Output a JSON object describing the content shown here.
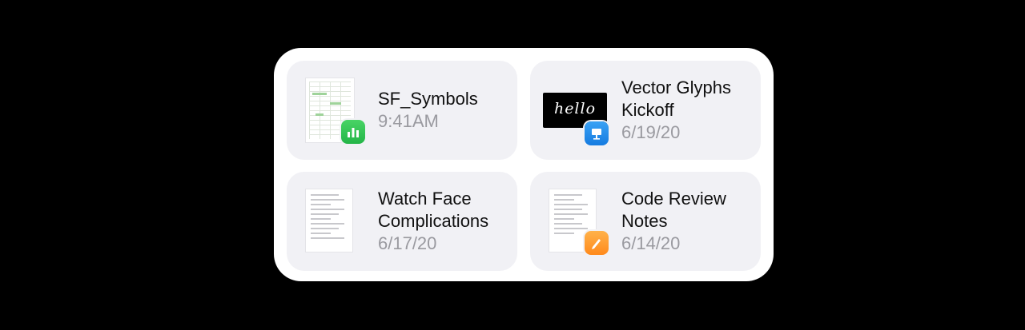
{
  "widget": {
    "items": [
      {
        "title_lines": [
          "SF_Symbols"
        ],
        "date": "9:41AM",
        "app_icon": "numbers-app-icon",
        "app_color": "#34c759"
      },
      {
        "title_lines": [
          "Vector Glyphs",
          "Kickoff"
        ],
        "date": "6/19/20",
        "app_icon": "keynote-app-icon",
        "app_color": "#1a84e6",
        "thumbnail_text": "hello"
      },
      {
        "title_lines": [
          "Watch Face",
          "Complications"
        ],
        "date": "6/17/20",
        "app_icon": "none"
      },
      {
        "title_lines": [
          "Code Review",
          "Notes"
        ],
        "date": "6/14/20",
        "app_icon": "pages-app-icon",
        "app_color": "#ff9f1c"
      }
    ]
  }
}
